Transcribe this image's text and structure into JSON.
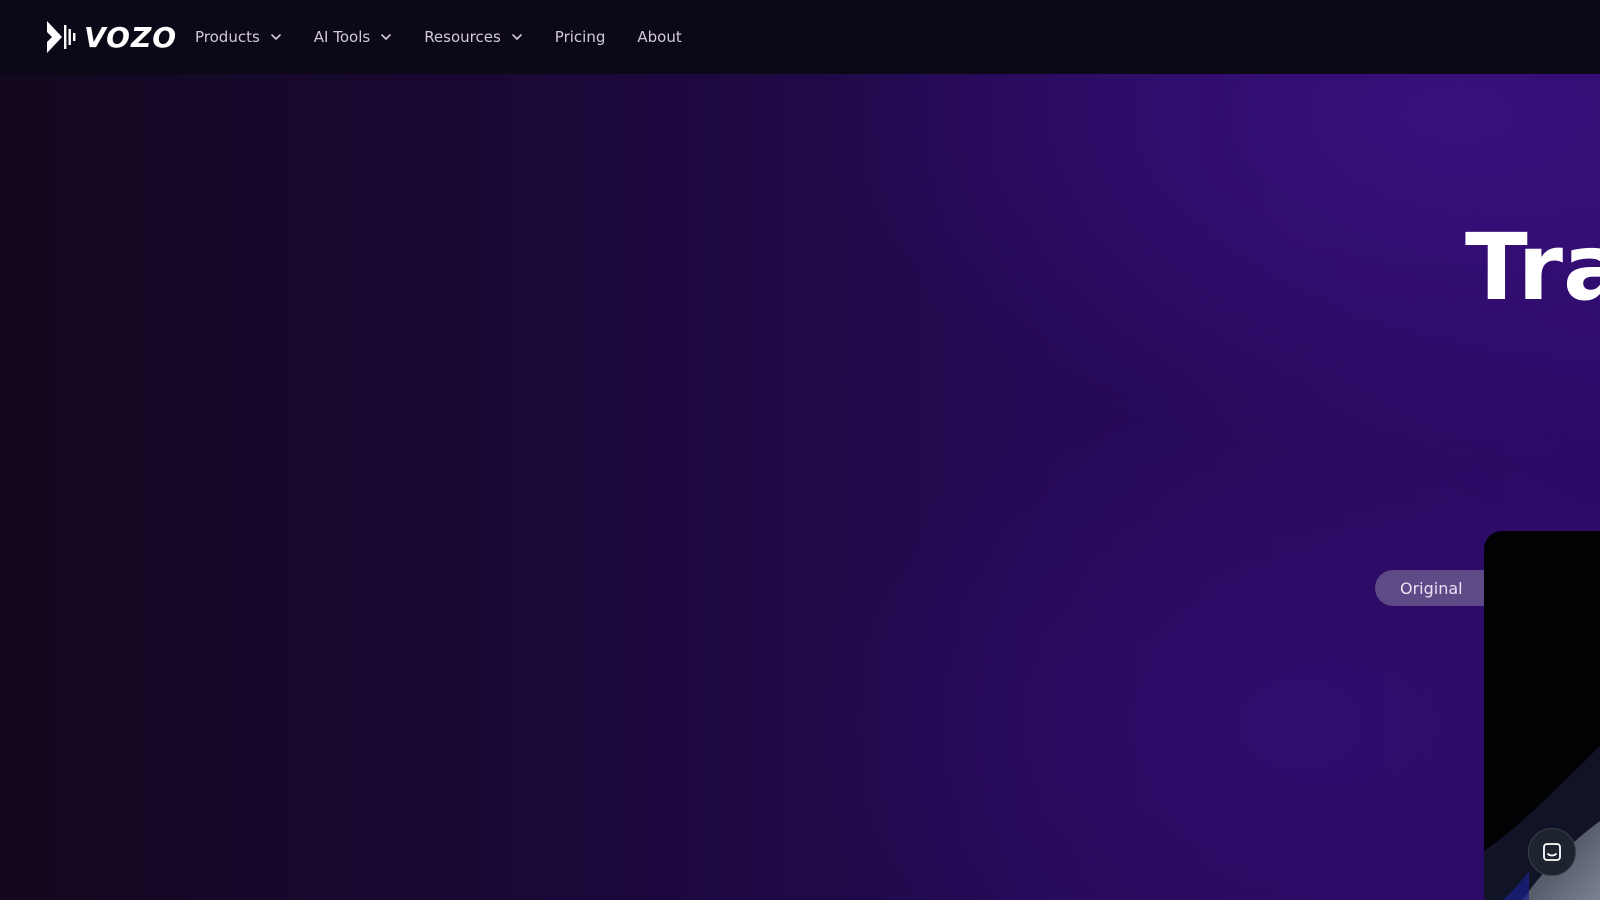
{
  "brand": {
    "name": "VOZO"
  },
  "nav": {
    "items": [
      {
        "label": "Products",
        "has_dropdown": true
      },
      {
        "label": "AI Tools",
        "has_dropdown": true
      },
      {
        "label": "Resources",
        "has_dropdown": true
      },
      {
        "label": "Pricing",
        "has_dropdown": false
      },
      {
        "label": "About",
        "has_dropdown": false
      }
    ]
  },
  "hero": {
    "title": "Tra",
    "original_label": "Original"
  },
  "icons": {
    "logo": "vozo-logo-icon",
    "dropdown": "chevron-down-icon",
    "chat": "chat-icon"
  },
  "colors": {
    "nav_background": "#0d0818",
    "hero_accent": "#2c0b66",
    "pill_background": "#5d4a86",
    "text_primary": "#ffffff"
  }
}
